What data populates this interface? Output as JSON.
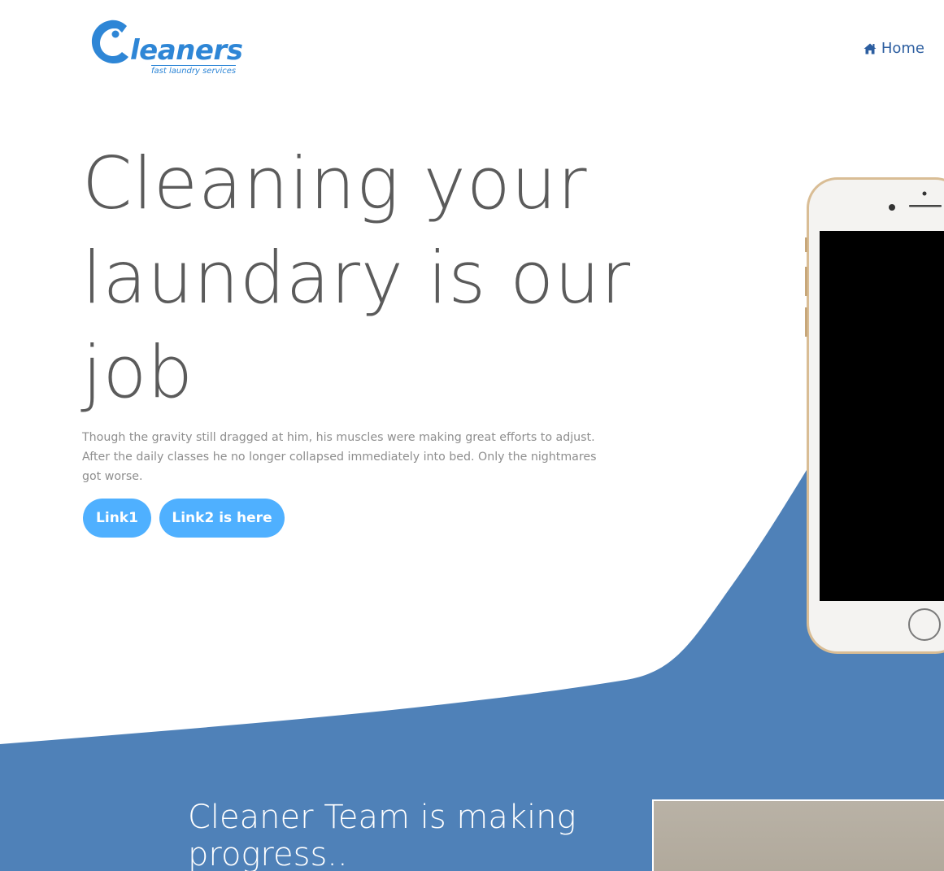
{
  "colors": {
    "brand_blue": "#2e86d6",
    "wave_blue": "#4f81b8",
    "button_blue": "#4fb0ff",
    "heading_gray": "#5b5b5b",
    "body_gray": "#8e8e8e",
    "nav_blue": "#2c5ea0"
  },
  "header": {
    "logo": {
      "word": "leaners",
      "tagline": "fast laundry services"
    },
    "nav": {
      "home_icon": "home-icon",
      "home_label": "Home"
    }
  },
  "hero": {
    "title": "Cleaning your laundary is our job",
    "text": "Though the gravity still dragged at him, his muscles were making great efforts to adjust. After the daily classes he no longer collapsed immediately into bed. Only the nightmares got worse.",
    "buttons": [
      {
        "label": "Link1"
      },
      {
        "label": "Link2 is here"
      }
    ]
  },
  "section2": {
    "title": "Cleaner Team is making progress.."
  }
}
